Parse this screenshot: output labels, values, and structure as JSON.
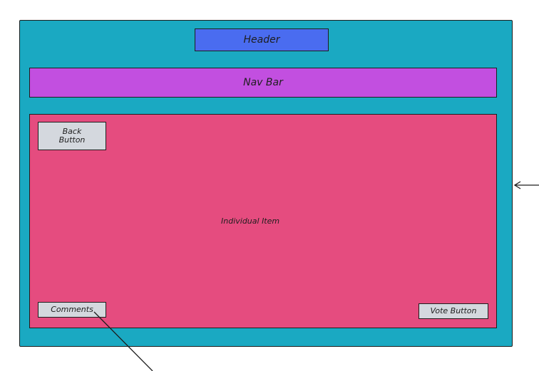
{
  "header": {
    "label": "Header"
  },
  "navbar": {
    "label": "Nav Bar"
  },
  "item": {
    "label": "Individual Item",
    "back_button_line1": "Back",
    "back_button_line2": "Button",
    "comments_button": "Comments",
    "vote_button": "Vote Button"
  },
  "colors": {
    "frame": "#1aa9c2",
    "header": "#4a6cf0",
    "navbar": "#c24fe0",
    "item": "#e54c7f",
    "button": "#d4d8de",
    "stroke": "#1e1e1e"
  }
}
